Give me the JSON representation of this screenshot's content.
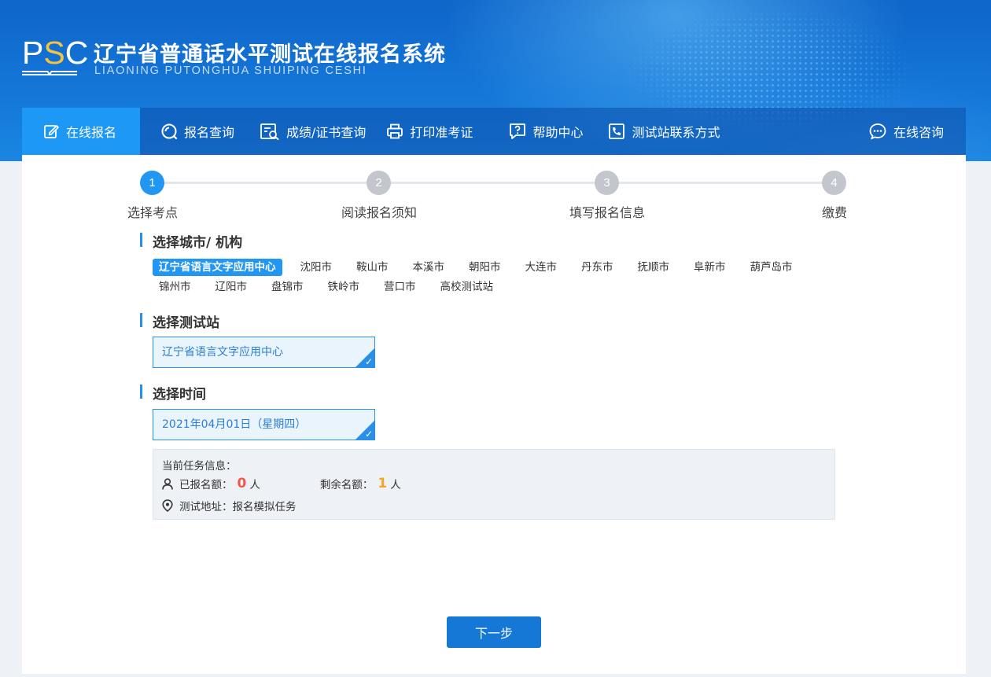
{
  "header": {
    "logo_text": "PSC",
    "title": "辽宁省普通话水平测试在线报名系统",
    "subtitle": "LIAONING PUTONGHUA SHUIPING CESHI"
  },
  "nav": {
    "items": [
      {
        "label": "在线报名",
        "icon": "edit-icon",
        "active": true
      },
      {
        "label": "报名查询",
        "icon": "search-icon"
      },
      {
        "label": "成绩/证书查询",
        "icon": "certificate-search-icon"
      },
      {
        "label": "打印准考证",
        "icon": "printer-icon"
      },
      {
        "label": "帮助中心",
        "icon": "help-icon"
      },
      {
        "label": "测试站联系方式",
        "icon": "phone-icon"
      }
    ],
    "consult": {
      "label": "在线咨询",
      "icon": "chat-icon"
    }
  },
  "steps": [
    {
      "num": "1",
      "label": "选择考点",
      "active": true
    },
    {
      "num": "2",
      "label": "阅读报名须知"
    },
    {
      "num": "3",
      "label": "填写报名信息"
    },
    {
      "num": "4",
      "label": "缴费"
    }
  ],
  "city_section": {
    "title": "选择城市/ 机构",
    "rows": [
      [
        "辽宁省语言文字应用中心",
        "沈阳市",
        "鞍山市",
        "本溪市",
        "朝阳市",
        "大连市",
        "丹东市",
        "抚顺市",
        "阜新市",
        "葫芦岛市"
      ],
      [
        "锦州市",
        "辽阳市",
        "盘锦市",
        "铁岭市",
        "营口市",
        "高校测试站"
      ]
    ],
    "selected": "辽宁省语言文字应用中心"
  },
  "station_section": {
    "title": "选择测试站",
    "selected": "辽宁省语言文字应用中心"
  },
  "time_section": {
    "title": "选择时间",
    "selected": "2021年04月01日（星期四）"
  },
  "task_info": {
    "heading": "当前任务信息：",
    "registered_label": "已报名额：",
    "registered_value": "0",
    "registered_unit": "人",
    "remaining_label": "剩余名额：",
    "remaining_value": "1",
    "remaining_unit": "人",
    "address_label": "测试地址：",
    "address_value": "报名模拟任务"
  },
  "actions": {
    "next_label": "下一步"
  },
  "colors": {
    "primary": "#2196f3",
    "nav_active": "#1e98f5",
    "registered": "#f0584e",
    "remaining": "#f5a523"
  }
}
